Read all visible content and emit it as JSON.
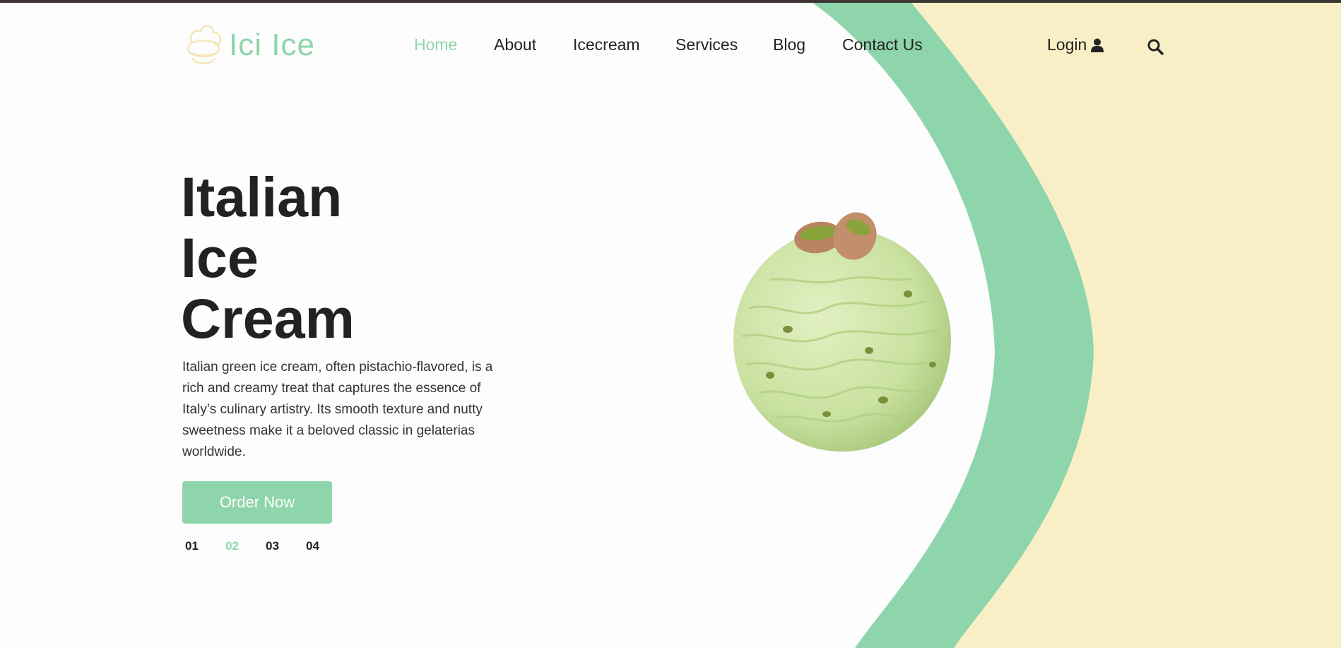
{
  "brand": {
    "name": "Ici Ice",
    "color": "#8fd5ab"
  },
  "nav": {
    "items": [
      {
        "label": "Home",
        "active": true
      },
      {
        "label": "About",
        "active": false
      },
      {
        "label": "Icecream",
        "active": false
      },
      {
        "label": "Services",
        "active": false
      },
      {
        "label": "Blog",
        "active": false
      },
      {
        "label": "Contact Us",
        "active": false
      }
    ],
    "login_label": "Login"
  },
  "hero": {
    "title_lines": [
      "Italian",
      "Ice",
      "Cream"
    ],
    "description": "Italian green ice cream, often pistachio-flavored, is a rich and creamy treat that captures the essence of Italy’s culinary artistry. Its smooth texture and nutty sweetness make it a beloved classic in gelaterias worldwide.",
    "cta_label": "Order Now"
  },
  "slider": {
    "pages": [
      "01",
      "02",
      "03",
      "04"
    ],
    "active_index": 1
  },
  "colors": {
    "accent_green": "#8fd5ab",
    "cream": "#f9efc6",
    "top_bar": "#3d3633",
    "text": "#222222"
  },
  "icons": [
    "ice-cream-logo-icon",
    "user-icon",
    "search-icon"
  ]
}
